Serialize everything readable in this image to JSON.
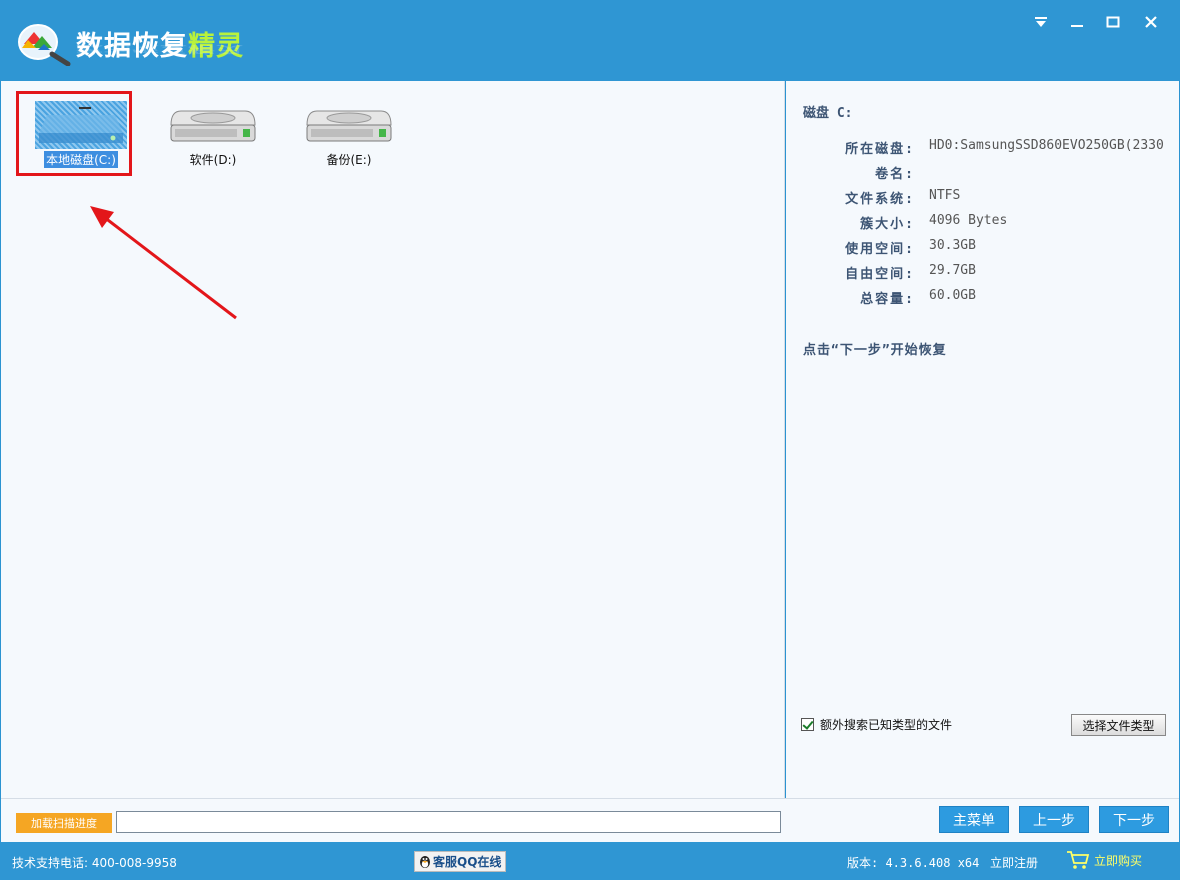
{
  "app": {
    "title_main": "数据恢复",
    "title_accent": "精灵"
  },
  "window_controls": {
    "menu_icon": "dropdown-icon",
    "minimize_icon": "minimize-icon",
    "maximize_icon": "maximize-icon",
    "close_icon": "close-icon"
  },
  "drives": [
    {
      "label": "本地磁盘(C:)",
      "selected": true
    },
    {
      "label": "软件(D:)",
      "selected": false
    },
    {
      "label": "备份(E:)",
      "selected": false
    }
  ],
  "disk_info": {
    "title": "磁盘 C:",
    "rows": [
      {
        "key": "所在磁盘:",
        "value": "HD0:SamsungSSD860EVO250GB(2330"
      },
      {
        "key": "卷名:",
        "value": ""
      },
      {
        "key": "文件系统:",
        "value": "NTFS"
      },
      {
        "key": "簇大小:",
        "value": "4096 Bytes"
      },
      {
        "key": "使用空间:",
        "value": "30.3GB"
      },
      {
        "key": "自由空间:",
        "value": "29.7GB"
      },
      {
        "key": "总容量:",
        "value": "60.0GB"
      }
    ],
    "hint": "点击“下一步”开始恢复"
  },
  "options": {
    "extra_search_label": "额外搜索已知类型的文件",
    "extra_search_checked": true,
    "choose_filetype_label": "选择文件类型"
  },
  "action_bar": {
    "load_scan_label": "加载扫描进度",
    "main_menu_label": "主菜单",
    "prev_label": "上一步",
    "next_label": "下一步"
  },
  "status": {
    "phone": "技术支持电话: 400-008-9958",
    "qq_label": "客服QQ在线",
    "version": "版本: 4.3.6.408 x64",
    "register_label": "立即注册",
    "buy_label": "立即购买"
  },
  "colors": {
    "titlebar": "#2f96d3",
    "accent_green": "#b8f23c",
    "highlight_red": "#e3161a",
    "button_blue": "#2d9be0",
    "load_button_orange": "#f5a623"
  }
}
